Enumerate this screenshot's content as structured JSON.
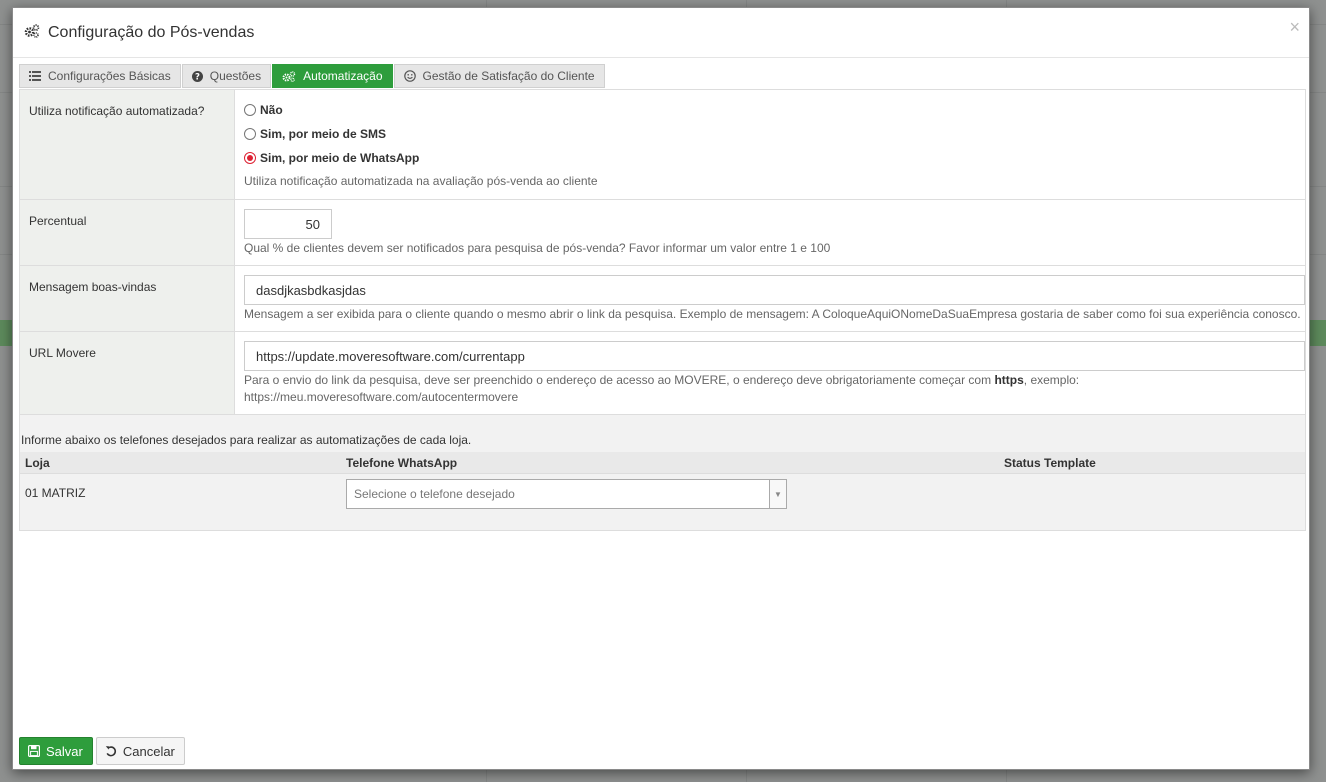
{
  "modal": {
    "title": "Configuração do Pós-vendas",
    "close_glyph": "×"
  },
  "tabs": [
    {
      "label": "Configurações Básicas",
      "icon": "list-icon"
    },
    {
      "label": "Questões",
      "icon": "question-icon"
    },
    {
      "label": "Automatização",
      "icon": "cogs-icon",
      "active": true
    },
    {
      "label": "Gestão de Satisfação do Cliente",
      "icon": "smile-icon"
    }
  ],
  "notification": {
    "label": "Utiliza notificação automatizada?",
    "options": [
      "Não",
      "Sim, por meio de SMS",
      "Sim, por meio de WhatsApp"
    ],
    "selected": "Sim, por meio de WhatsApp",
    "help": "Utiliza notificação automatizada na avaliação pós-venda ao cliente"
  },
  "percentual": {
    "label": "Percentual",
    "value": "50",
    "help": "Qual % de clientes devem ser notificados para pesquisa de pós-venda? Favor informar um valor entre 1 e 100"
  },
  "welcome": {
    "label": "Mensagem boas-vindas",
    "value": "dasdjkasbdkasjdas",
    "help": "Mensagem a ser exibida para o cliente quando o mesmo abrir o link da pesquisa. Exemplo de mensagem: A ColoqueAquiONomeDaSuaEmpresa gostaria de saber como foi sua experiência conosco."
  },
  "url": {
    "label": "URL Movere",
    "value": "https://update.moveresoftware.com/currentapp",
    "help_before": "Para o envio do link da pesquisa, deve ser preenchido o endereço de acesso ao MOVERE, o endereço deve obrigatoriamente começar com ",
    "help_bold": "https",
    "help_after": ", exemplo:",
    "help_example": "https://meu.moveresoftware.com/autocentermovere"
  },
  "phones": {
    "info": "Informe abaixo os telefones desejados para realizar as automatizações de cada loja.",
    "headers": [
      "Loja",
      "Telefone WhatsApp",
      "Status Template"
    ],
    "rows": [
      {
        "loja": "01 MATRIZ",
        "placeholder": "Selecione o telefone desejado",
        "status": ""
      }
    ]
  },
  "footer": {
    "save_label": "Salvar",
    "cancel_label": "Cancelar"
  },
  "colors": {
    "accent": "#2e9d3c",
    "radio_selected": "#dd2233"
  }
}
